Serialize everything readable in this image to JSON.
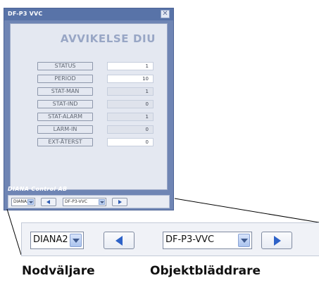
{
  "window": {
    "title": "DF-P3 VVC",
    "close_glyph": "✕",
    "panel_title": "AVVIKELSE DIU",
    "brand": "DIANA Control AB",
    "background": "#6f85b4"
  },
  "fields": [
    {
      "label": "STATUS",
      "value": "1",
      "editable": true
    },
    {
      "label": "PERIOD",
      "value": "10",
      "editable": true
    },
    {
      "label": "STAT-MAN",
      "value": "1",
      "editable": false
    },
    {
      "label": "STAT-IND",
      "value": "0",
      "editable": false
    },
    {
      "label": "STAT-ALARM",
      "value": "1",
      "editable": false
    },
    {
      "label": "LARM-IN",
      "value": "0",
      "editable": false
    },
    {
      "label": "EXT-ÅTERST",
      "value": "0",
      "editable": true
    }
  ],
  "footer": {
    "node_value": "DIANA2",
    "object_value": "DF-P3-VVC",
    "prev_icon": "arrow-left-icon",
    "next_icon": "arrow-right-icon"
  },
  "zoom": {
    "node_value": "DIANA2",
    "object_value": "DF-P3-VVC"
  },
  "captions": {
    "node_selector": "Nodväljare",
    "object_browser": "Objektbläddrare"
  }
}
